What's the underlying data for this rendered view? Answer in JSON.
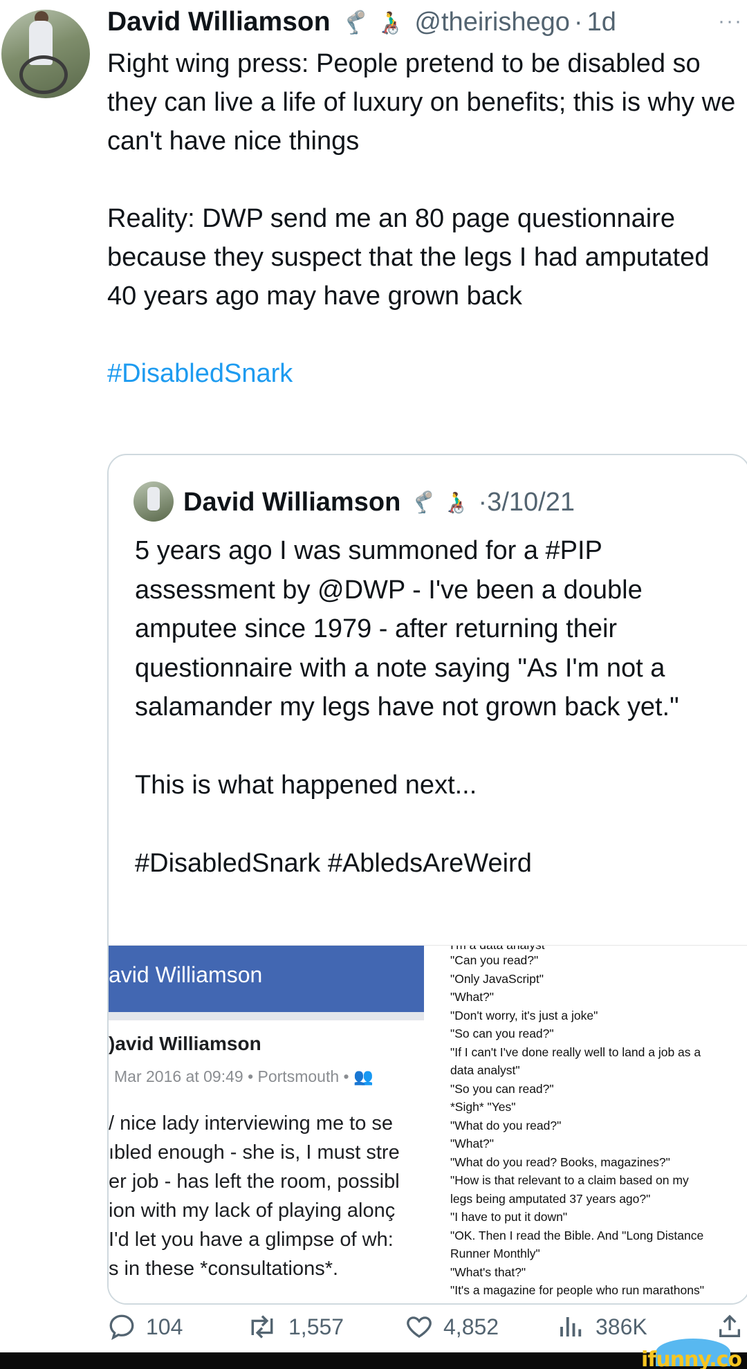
{
  "tweet": {
    "author_name": "David Williamson",
    "author_emojis": "🦿 👨‍🦽",
    "handle": "@theirishego",
    "separator": "·",
    "time": "1d",
    "more": "···",
    "paragraphs": [
      "Right wing press: People pretend to be disabled so they can live a life of luxury on benefits; this is why we can't have nice things",
      "Reality: DWP send me an 80 page questionnaire because they suspect that the legs I had amputated 40 years ago may have grown back"
    ],
    "hashtag": "#DisabledSnark"
  },
  "quoted": {
    "author_name": "David Williamson",
    "author_emojis": "🦿 👨‍🦽",
    "date": "·3/10/21",
    "paragraphs": [
      "5 years ago I was summoned for a #PIP assessment by @DWP - I've been a double amputee since 1979 - after returning their questionnaire with a note saying \"As I'm not a salamander my legs have not grown back yet.\"",
      "This is what happened next...",
      "#DisabledSnark #AbledsAreWeird"
    ],
    "media": {
      "fb_header_title": "avid Williamson",
      "fb_name": ")avid Williamson",
      "fb_meta": "Mar 2016 at 09:49 • Portsmouth • 👥",
      "fb_post_lines": [
        "/ nice lady interviewing me to se",
        "ıbled enough - she is, I must stre",
        "er job - has left the room, possibl",
        "ion with my lack of playing alonç",
        " I'd let you have a glimpse of wh:",
        "s in these *consultations*."
      ],
      "chat_cut_line": "I'm a data analyst",
      "chat_lines": [
        "\"Can you read?\"",
        "\"Only JavaScript\"",
        "\"What?\"",
        "\"Don't worry, it's just a joke\"",
        "\"So can you read?\"",
        "\"If I can't I've done really well to land a job as a",
        "data analyst\"",
        "\"So you can read?\"",
        "*Sigh* \"Yes\"",
        "\"What do you read?\"",
        "\"What?\"",
        "\"What do you read? Books, magazines?\"",
        "\"How is that relevant to a claim based on my",
        "legs being amputated 37 years ago?\"",
        "\"I have to put it down\"",
        "\"OK. Then I read the Bible. And \"Long Distance",
        "Runner Monthly\"",
        "\"What's that?\"",
        "\"It's a magazine for people who run marathons\""
      ]
    }
  },
  "actions": {
    "replies": "104",
    "retweets": "1,557",
    "likes": "4,852",
    "views": "386K"
  },
  "watermark": "ifunny.co"
}
